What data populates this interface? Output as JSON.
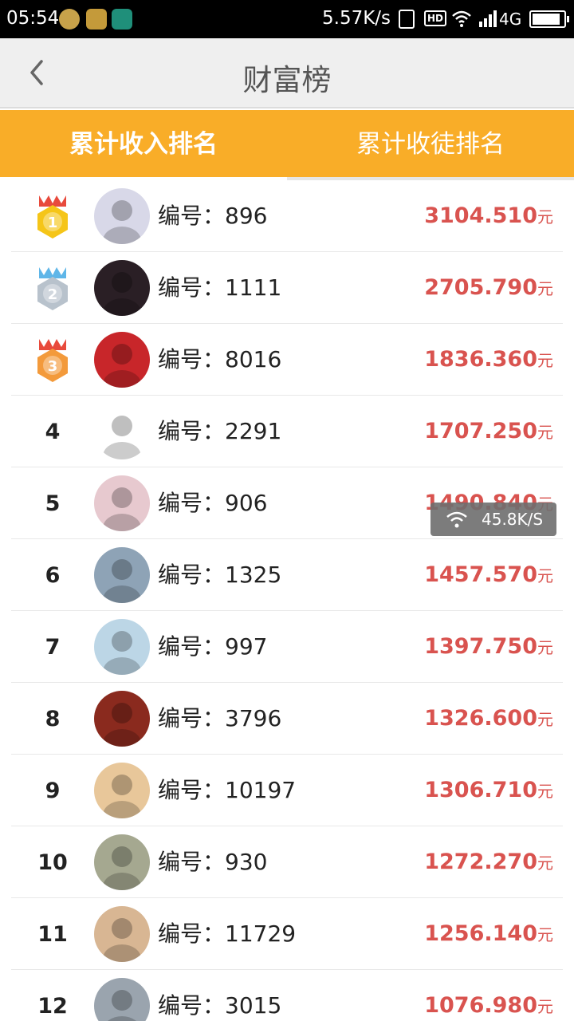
{
  "status_bar": {
    "time": "05:54",
    "net_speed": "5.57K/s",
    "hd": "HD",
    "network": "4G"
  },
  "header": {
    "title": "财富榜"
  },
  "tabs": [
    {
      "label": "累计收入排名",
      "active": true
    },
    {
      "label": "累计收徒排名",
      "active": false
    }
  ],
  "list": {
    "id_prefix": "编号：",
    "currency_unit": "元",
    "rows": [
      {
        "rank": "1",
        "medal": "gold-medal-icon",
        "id": "896",
        "amount": "3104.510",
        "avatar_color": "#d8d8e8"
      },
      {
        "rank": "2",
        "medal": "silver-medal-icon",
        "id": "1111",
        "amount": "2705.790",
        "avatar_color": "#2a1f25"
      },
      {
        "rank": "3",
        "medal": "bronze-medal-icon",
        "id": "8016",
        "amount": "1836.360",
        "avatar_color": "#c8262a"
      },
      {
        "rank": "4",
        "id": "2291",
        "amount": "1707.250",
        "avatar_color": "#ffffff"
      },
      {
        "rank": "5",
        "id": "906",
        "amount": "1490.840",
        "avatar_color": "#e7c9cf"
      },
      {
        "rank": "6",
        "id": "1325",
        "amount": "1457.570",
        "avatar_color": "#8ea3b6"
      },
      {
        "rank": "7",
        "id": "997",
        "amount": "1397.750",
        "avatar_color": "#bcd6e6"
      },
      {
        "rank": "8",
        "id": "3796",
        "amount": "1326.600",
        "avatar_color": "#8a2a1e"
      },
      {
        "rank": "9",
        "id": "10197",
        "amount": "1306.710",
        "avatar_color": "#e8c79a"
      },
      {
        "rank": "10",
        "id": "930",
        "amount": "1272.270",
        "avatar_color": "#a5a890"
      },
      {
        "rank": "11",
        "id": "11729",
        "amount": "1256.140",
        "avatar_color": "#d8b693"
      },
      {
        "rank": "12",
        "id": "3015",
        "amount": "1076.980",
        "avatar_color": "#9aa4ae"
      }
    ]
  },
  "toast": {
    "speed": "45.8K/S"
  },
  "colors": {
    "accent": "#f9ad28",
    "amount": "#d9534f",
    "header_bg": "#efefef"
  }
}
